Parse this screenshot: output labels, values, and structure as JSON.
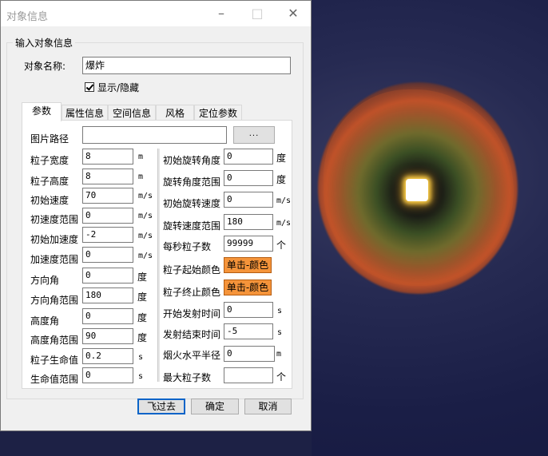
{
  "window": {
    "title": "对象信息"
  },
  "group_label": "输入对象信息",
  "object_name": {
    "label": "对象名称:",
    "value": "爆炸"
  },
  "visibility": {
    "label": "显示/隐藏",
    "checked": true
  },
  "tabs": [
    {
      "label": "参数",
      "active": true
    },
    {
      "label": "属性信息"
    },
    {
      "label": "空间信息"
    },
    {
      "label": "风格"
    },
    {
      "label": "定位参数"
    }
  ],
  "image_path": {
    "label": "图片路径",
    "value": "",
    "browse_label": "..."
  },
  "left_fields": [
    {
      "label": "粒子宽度",
      "value": "8",
      "unit": "m"
    },
    {
      "label": "粒子高度",
      "value": "8",
      "unit": "m"
    },
    {
      "label": "初始速度",
      "value": "70",
      "unit": "m/s"
    },
    {
      "label": "初速度范围",
      "value": "0",
      "unit": "m/s"
    },
    {
      "label": "初始加速度",
      "value": "-2",
      "unit": "m/s"
    },
    {
      "label": "加速度范围",
      "value": "0",
      "unit": "m/s"
    },
    {
      "label": "方向角",
      "value": "0",
      "unit": "度"
    },
    {
      "label": "方向角范围",
      "value": "180",
      "unit": "度"
    },
    {
      "label": "高度角",
      "value": "0",
      "unit": "度"
    },
    {
      "label": "高度角范围",
      "value": "90",
      "unit": "度"
    },
    {
      "label": "粒子生命值",
      "value": "0.2",
      "unit": "s"
    },
    {
      "label": "生命值范围",
      "value": "0",
      "unit": "s"
    }
  ],
  "right_fields": [
    {
      "label": "初始旋转角度",
      "value": "0",
      "unit": "度"
    },
    {
      "label": "旋转角度范围",
      "value": "0",
      "unit": "度"
    },
    {
      "label": "初始旋转速度",
      "value": "0",
      "unit": "m/s"
    },
    {
      "label": "旋转速度范围",
      "value": "180",
      "unit": "m/s"
    },
    {
      "label": "每秒粒子数",
      "value": "99999",
      "unit": "个"
    },
    {
      "label": "粒子起始颜色",
      "button": "单击-颜色"
    },
    {
      "label": "粒子终止颜色",
      "button": "单击-颜色"
    },
    {
      "label": "开始发射时间",
      "value": "0",
      "unit": "s"
    },
    {
      "label": "发射结束时间",
      "value": "-5",
      "unit": "s"
    },
    {
      "label": "烟火水平半径",
      "value": "0",
      "unit": "m"
    },
    {
      "label": "最大粒子数",
      "value": "",
      "unit": "个"
    }
  ],
  "buttons": {
    "fly": "飞过去",
    "ok": "确定",
    "cancel": "取消"
  },
  "colors": {
    "color_button": "#f5943a",
    "default_button_border": "#0a64c8",
    "background": "#1a1e46"
  }
}
